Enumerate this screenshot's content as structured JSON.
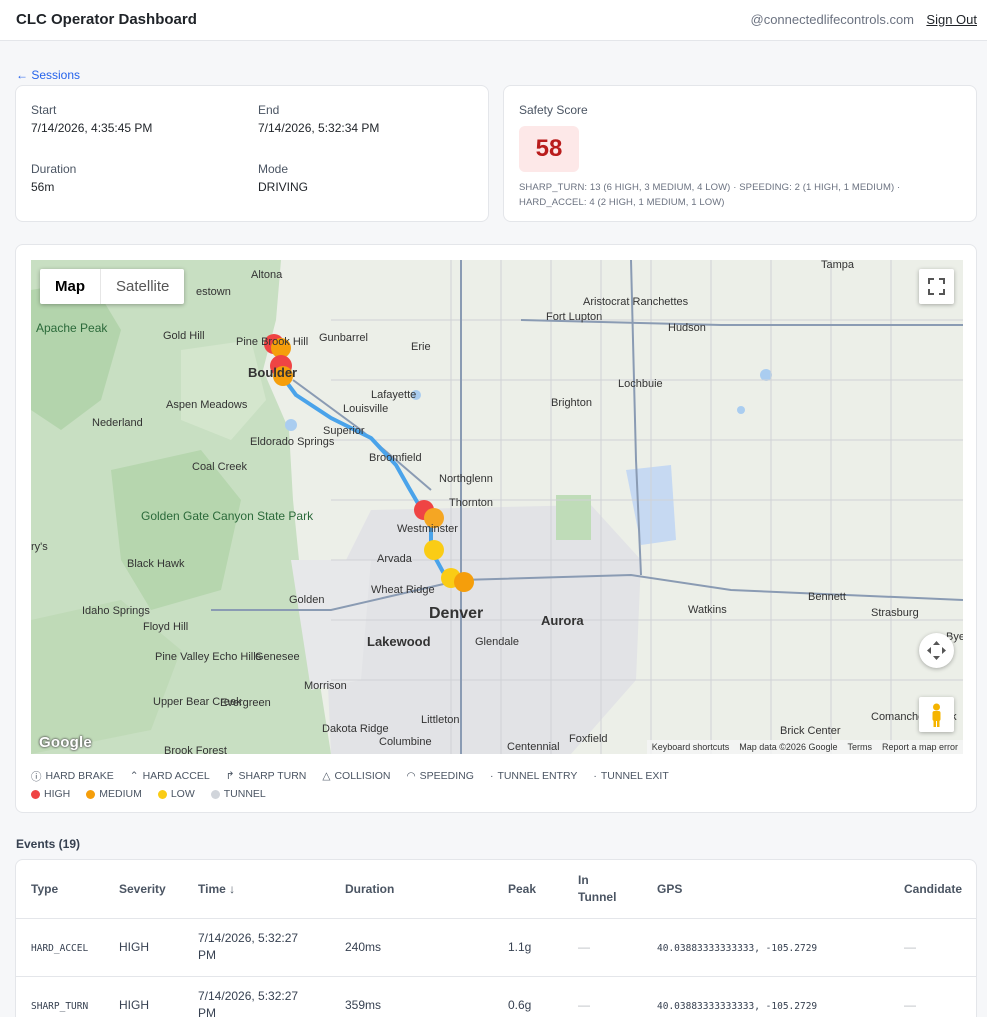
{
  "header": {
    "title": "CLC Operator Dashboard",
    "user_email": "@connectedlifecontrols.com",
    "sign_out": "Sign Out"
  },
  "back_link": "← Sessions",
  "session": {
    "start_label": "Start",
    "start_value": "7/14/2026, 4:35:45 PM",
    "end_label": "End",
    "end_value": "7/14/2026, 5:32:34 PM",
    "duration_label": "Duration",
    "duration_value": "56m",
    "mode_label": "Mode",
    "mode_value": "DRIVING"
  },
  "safety": {
    "label": "Safety Score",
    "score": "58",
    "breakdown": "SHARP_TURN: 13 (6 HIGH, 3 MEDIUM, 4 LOW) · SPEEDING: 2 (1 HIGH, 1 MEDIUM) · HARD_ACCEL: 4 (2 HIGH, 1 MEDIUM, 1 LOW)"
  },
  "map": {
    "type_map": "Map",
    "type_satellite": "Satellite",
    "logo": "Google",
    "attribution": {
      "shortcuts": "Keyboard shortcuts",
      "data": "Map data ©2026 Google",
      "terms": "Terms",
      "report": "Report a map error"
    },
    "places": {
      "altona": "Altona",
      "westown": "estown",
      "gold_hill": "Gold Hill",
      "apache": "Apache Peak",
      "pine_brook": "Pine Brook Hill",
      "boulder": "Boulder",
      "gunbarrel": "Gunbarrel",
      "erie": "Erie",
      "aristocrat": "Aristocrat Ranchettes",
      "fort_lupton": "Fort Lupton",
      "hudson": "Hudson",
      "lochbuie": "Lochbuie",
      "lafayette": "Lafayette",
      "louisville": "Louisville",
      "superior": "Superior",
      "brighton": "Brighton",
      "aspen": "Aspen Meadows",
      "nederland": "Nederland",
      "eldorado": "Eldorado Springs",
      "coal_creek": "Coal Creek",
      "broomfield": "Broomfield",
      "northglenn": "Northglenn",
      "thornton": "Thornton",
      "westminster": "Westminster",
      "golden_gate": "Golden Gate Canyon State Park",
      "ry": "ry's",
      "black_hawk": "Black Hawk",
      "arvada": "Arvada",
      "wheat_ridge": "Wheat Ridge",
      "denver": "Denver",
      "aurora": "Aurora",
      "idaho": "Idaho Springs",
      "golden": "Golden",
      "watkins": "Watkins",
      "bennett": "Bennett",
      "strasburg": "Strasburg",
      "floyd": "Floyd Hill",
      "lakewood": "Lakewood",
      "glendale": "Glendale",
      "pine_valley": "Pine Valley Echo Hills",
      "genesee": "Genesee",
      "morrison": "Morrison",
      "upper_bear": "Upper Bear Creek",
      "evergreen": "Evergreen",
      "dakota": "Dakota Ridge",
      "littleton": "Littleton",
      "columbine": "Columbine",
      "centennial": "Centennial",
      "foxfield": "Foxfield",
      "brick": "Brick Center",
      "comanche": "Comanche Creek",
      "brook_forest": "Brook Forest",
      "tampa": "Tampa",
      "bye": "Bye"
    }
  },
  "legend": {
    "types": [
      "HARD BRAKE",
      "HARD ACCEL",
      "SHARP TURN",
      "COLLISION",
      "SPEEDING",
      "TUNNEL ENTRY",
      "TUNNEL EXIT"
    ],
    "severity": [
      {
        "label": "HIGH",
        "color": "#ef4444"
      },
      {
        "label": "MEDIUM",
        "color": "#f59e0b"
      },
      {
        "label": "LOW",
        "color": "#facc15"
      },
      {
        "label": "TUNNEL",
        "color": "#d1d5db"
      }
    ]
  },
  "events": {
    "title": "Events (19)",
    "columns": [
      "Type",
      "Severity",
      "Time ↓",
      "Duration",
      "Peak",
      "In Tunnel",
      "GPS",
      "Candidate"
    ],
    "rows": [
      {
        "type": "HARD_ACCEL",
        "severity": "HIGH",
        "time": "7/14/2026, 5:32:27 PM",
        "duration": "240ms",
        "peak": "1.1g",
        "in_tunnel": "—",
        "gps": "40.03883333333333, -105.2729",
        "candidate": "—"
      },
      {
        "type": "SHARP_TURN",
        "severity": "HIGH",
        "time": "7/14/2026, 5:32:27 PM",
        "duration": "359ms",
        "peak": "0.6g",
        "in_tunnel": "—",
        "gps": "40.03883333333333, -105.2729",
        "candidate": "—"
      }
    ]
  }
}
